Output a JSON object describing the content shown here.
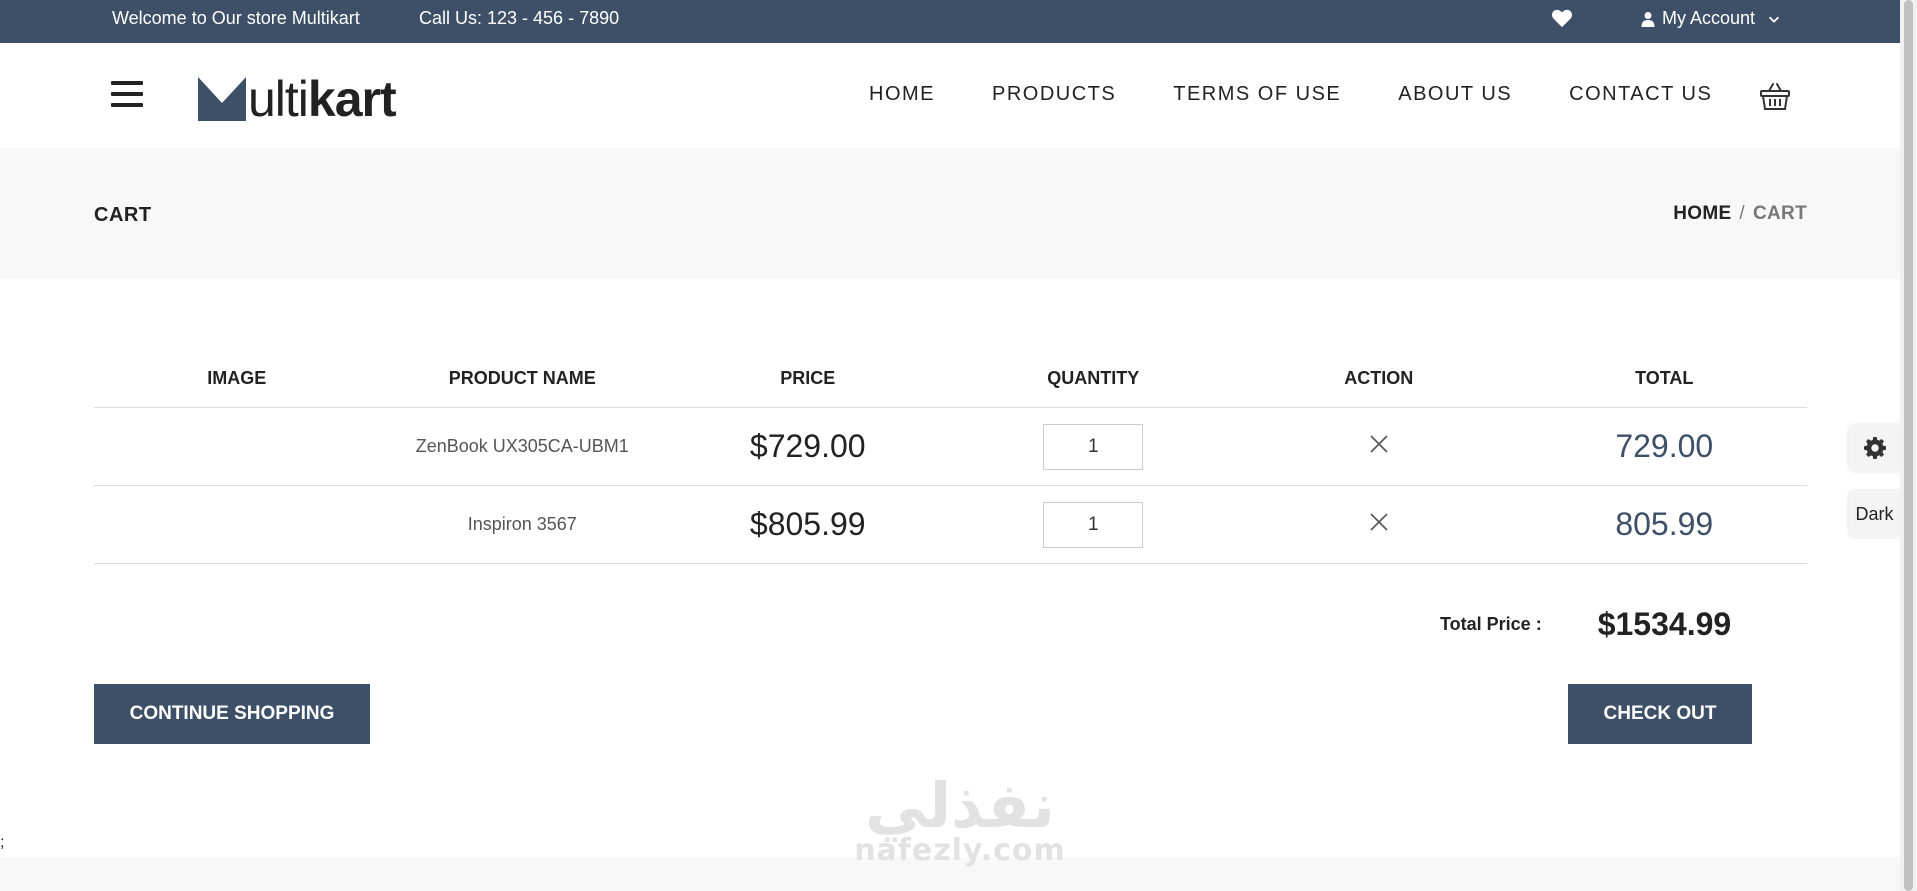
{
  "topbar": {
    "welcome": "Welcome to Our store Multikart",
    "call": "Call Us: 123 - 456 - 7890",
    "account_label": "My Account"
  },
  "header": {
    "logo_light": "ulti",
    "logo_bold": "kart",
    "nav": [
      "HOME",
      "PRODUCTS",
      "TERMS OF USE",
      "ABOUT US",
      "CONTACT US"
    ]
  },
  "breadcrumb": {
    "title": "CART",
    "home": "HOME",
    "separator": "/",
    "current": "CART"
  },
  "table": {
    "headers": [
      "IMAGE",
      "PRODUCT NAME",
      "PRICE",
      "QUANTITY",
      "ACTION",
      "TOTAL"
    ],
    "rows": [
      {
        "name": "ZenBook UX305CA-UBM1",
        "price": "$729.00",
        "quantity": "1",
        "total": "729.00"
      },
      {
        "name": "Inspiron 3567",
        "price": "$805.99",
        "quantity": "1",
        "total": "805.99"
      }
    ]
  },
  "summary": {
    "label": "Total Price :",
    "value": "$1534.99"
  },
  "buttons": {
    "continue": "CONTINUE SHOPPING",
    "checkout": "CHECK OUT"
  },
  "side": {
    "dark_label": "Dark"
  },
  "stray_text": ";",
  "watermark": {
    "arabic": "نفذلي",
    "latin": "nafezly.com"
  },
  "colors": {
    "primary": "#3e5068",
    "section_bg": "#f8f8f8"
  },
  "icons": [
    "heart-icon",
    "user-icon",
    "chevron-down-icon",
    "hamburger-icon",
    "basket-icon",
    "close-icon",
    "gear-icon"
  ]
}
